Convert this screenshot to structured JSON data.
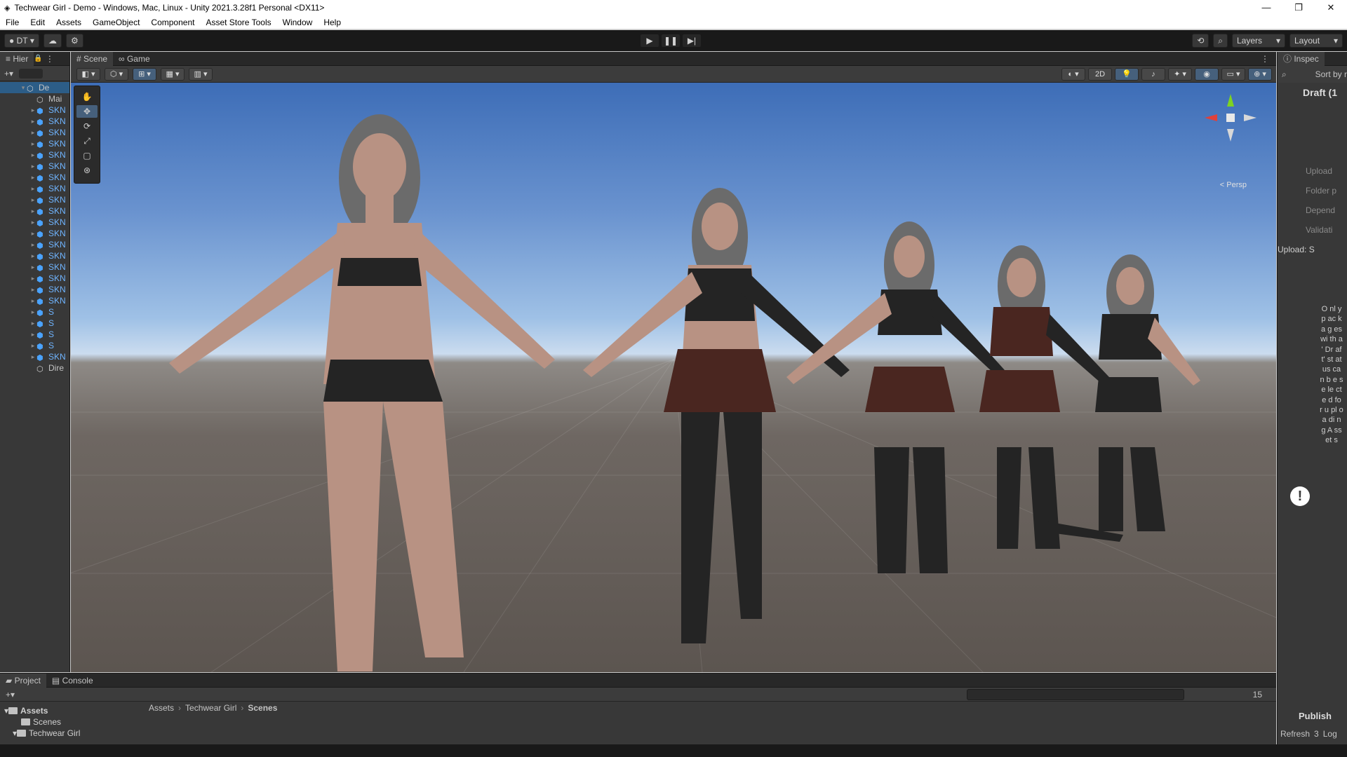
{
  "window": {
    "title": "Techwear Girl - Demo - Windows, Mac, Linux - Unity 2021.3.28f1 Personal <DX11>",
    "controls": [
      "—",
      "❐",
      "✕"
    ]
  },
  "menu": [
    "File",
    "Edit",
    "Assets",
    "GameObject",
    "Component",
    "Asset Store Tools",
    "Window",
    "Help"
  ],
  "toolbar": {
    "account": "DT",
    "layers": "Layers",
    "layout": "Layout"
  },
  "hierarchy": {
    "tab": "Hier",
    "items": [
      {
        "label": "De",
        "kind": "scene"
      },
      {
        "label": "Mai",
        "kind": "object"
      },
      {
        "label": "SKN",
        "kind": "prefab"
      },
      {
        "label": "SKN",
        "kind": "prefab"
      },
      {
        "label": "SKN",
        "kind": "prefab"
      },
      {
        "label": "SKN",
        "kind": "prefab"
      },
      {
        "label": "SKN",
        "kind": "prefab"
      },
      {
        "label": "SKN",
        "kind": "prefab"
      },
      {
        "label": "SKN",
        "kind": "prefab"
      },
      {
        "label": "SKN",
        "kind": "prefab"
      },
      {
        "label": "SKN",
        "kind": "prefab"
      },
      {
        "label": "SKN",
        "kind": "prefab"
      },
      {
        "label": "SKN",
        "kind": "prefab"
      },
      {
        "label": "SKN",
        "kind": "prefab"
      },
      {
        "label": "SKN",
        "kind": "prefab"
      },
      {
        "label": "SKN",
        "kind": "prefab"
      },
      {
        "label": "SKN",
        "kind": "prefab"
      },
      {
        "label": "SKN",
        "kind": "prefab"
      },
      {
        "label": "SKN",
        "kind": "prefab"
      },
      {
        "label": "SKN",
        "kind": "prefab"
      },
      {
        "label": "S",
        "kind": "prefab"
      },
      {
        "label": "S",
        "kind": "prefab"
      },
      {
        "label": "S",
        "kind": "prefab"
      },
      {
        "label": "S",
        "kind": "prefab"
      },
      {
        "label": "SKN",
        "kind": "prefab"
      },
      {
        "label": "Dire",
        "kind": "object"
      }
    ]
  },
  "scene": {
    "tabs": [
      "Scene",
      "Game"
    ],
    "two_d_label": "2D",
    "persp_label": "< Persp"
  },
  "inspector": {
    "tab": "Inspec",
    "sort_label": "Sort by r",
    "title": "Draft (1",
    "rows": [
      "Upload",
      "Folder p",
      "Depend",
      "Validati"
    ],
    "upload_label": "Upload: S",
    "vertical_message": "O nl y p ac ka g es wi th a ' Dr af t' st at us ca n b e se le ct e d fo r u pl oa di n g A ss et s",
    "publish": "Publish",
    "refresh": "Refresh",
    "log": "Log",
    "count": "3"
  },
  "project": {
    "tabs": [
      "Project",
      "Console"
    ],
    "tree": [
      "Assets",
      "Scenes",
      "Techwear Girl"
    ],
    "breadcrumb": [
      "Assets",
      "Techwear Girl",
      "Scenes"
    ],
    "hidden_count": "15"
  },
  "colors": {
    "accent": "#46607c",
    "selection": "#2c5d87",
    "prefab_blue": "#4aa3ff"
  }
}
